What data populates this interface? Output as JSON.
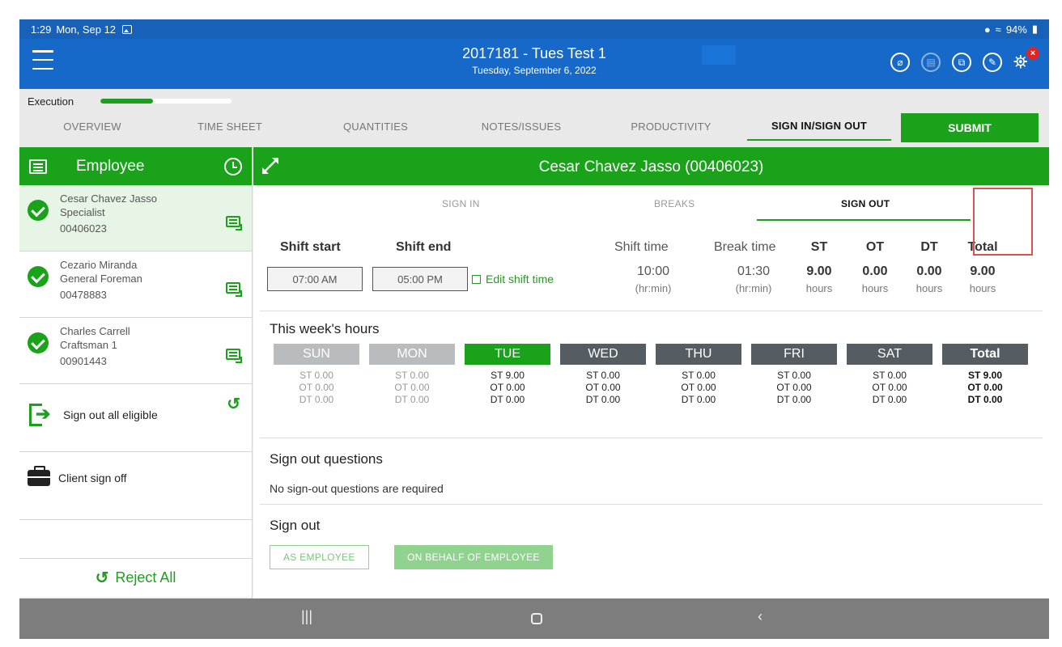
{
  "status_bar": {
    "time": "1:29",
    "date": "Mon, Sep 12",
    "battery": "94%"
  },
  "app_bar": {
    "title": "2017181 - Tues Test 1",
    "subtitle": "Tuesday, September 6, 2022"
  },
  "progress": {
    "label": "Execution",
    "value": 0.4
  },
  "tabs": [
    "OVERVIEW",
    "TIME SHEET",
    "QUANTITIES",
    "NOTES/ISSUES",
    "PRODUCTIVITY",
    "SIGN IN/SIGN OUT"
  ],
  "active_tab": "SIGN IN/SIGN OUT",
  "submit_label": "SUBMIT",
  "sidebar": {
    "header": "Employee",
    "employees": [
      {
        "name": "Cesar Chavez Jasso",
        "role": "Specialist",
        "id": "00406023",
        "selected": true
      },
      {
        "name": "Cezario Miranda",
        "role": "General Foreman",
        "id": "00478883",
        "selected": false
      },
      {
        "name": "Charles Carrell",
        "role": "Craftsman 1",
        "id": "00901443",
        "selected": false
      }
    ],
    "sign_out_all": "Sign out all eligible",
    "client_sign_off": "Client sign off",
    "reject_all": "Reject All"
  },
  "main": {
    "employee_title": "Cesar Chavez Jasso (00406023)",
    "subtabs": [
      "SIGN IN",
      "BREAKS",
      "SIGN OUT"
    ],
    "active_subtab": "SIGN OUT",
    "shift": {
      "start_label": "Shift start",
      "end_label": "Shift end",
      "start_value": "07:00 AM",
      "end_value": "05:00 PM",
      "edit_label": "Edit shift time",
      "shift_time_label": "Shift time",
      "shift_time_value": "10:00",
      "break_time_label": "Break time",
      "break_time_value": "01:30",
      "hrmin": "(hr:min)",
      "st_label": "ST",
      "st_value": "9.00",
      "ot_label": "OT",
      "ot_value": "0.00",
      "dt_label": "DT",
      "dt_value": "0.00",
      "total_label": "Total",
      "total_value": "9.00",
      "hours_unit": "hours"
    },
    "week": {
      "title": "This week's hours",
      "days": [
        {
          "name": "SUN",
          "st": "ST 0.00",
          "ot": "OT 0.00",
          "dt": "DT 0.00"
        },
        {
          "name": "MON",
          "st": "ST 0.00",
          "ot": "OT 0.00",
          "dt": "DT 0.00"
        },
        {
          "name": "TUE",
          "st": "ST 9.00",
          "ot": "OT 0.00",
          "dt": "DT 0.00"
        },
        {
          "name": "WED",
          "st": "ST 0.00",
          "ot": "OT 0.00",
          "dt": "DT 0.00"
        },
        {
          "name": "THU",
          "st": "ST 0.00",
          "ot": "OT 0.00",
          "dt": "DT 0.00"
        },
        {
          "name": "FRI",
          "st": "ST 0.00",
          "ot": "OT 0.00",
          "dt": "DT 0.00"
        },
        {
          "name": "SAT",
          "st": "ST 0.00",
          "ot": "OT 0.00",
          "dt": "DT 0.00"
        },
        {
          "name": "Total",
          "st": "ST 9.00",
          "ot": "OT 0.00",
          "dt": "DT 0.00"
        }
      ]
    },
    "questions": {
      "title": "Sign out questions",
      "note": "No sign-out questions are required"
    },
    "sign_out": {
      "title": "Sign out",
      "as_employee": "AS EMPLOYEE",
      "on_behalf": "ON BEHALF OF EMPLOYEE"
    }
  },
  "icons": [
    "menu-icon",
    "paperclip-icon",
    "document-icon",
    "copy-icon",
    "pen-icon",
    "satellite-icon",
    "close-icon",
    "list-icon",
    "clock-icon",
    "check-icon",
    "chat-icon",
    "sign-out-icon",
    "refresh-icon",
    "briefcase-icon",
    "expand-icon",
    "edit-icon"
  ],
  "colors": {
    "app_bar": "#1769c9",
    "accent_green": "#1aa31a",
    "highlight": "#d9534f"
  }
}
